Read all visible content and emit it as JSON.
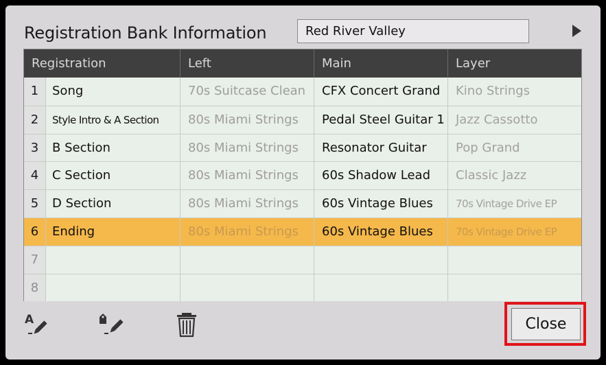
{
  "dialog": {
    "title": "Registration Bank Information",
    "bank_name": "Red River Valley",
    "close_label": "Close"
  },
  "table": {
    "headers": [
      "Registration",
      "Left",
      "Main",
      "Layer"
    ],
    "rows": [
      {
        "num": "1",
        "name": "Song",
        "left": "70s Suitcase Clean",
        "main": "CFX Concert Grand",
        "layer": "Kino Strings"
      },
      {
        "num": "2",
        "name": "Style Intro & A Section",
        "left": "80s Miami Strings",
        "main": "Pedal Steel Guitar 1",
        "layer": "Jazz Cassotto"
      },
      {
        "num": "3",
        "name": "B Section",
        "left": "80s Miami Strings",
        "main": "Resonator Guitar",
        "layer": "Pop Grand"
      },
      {
        "num": "4",
        "name": "C Section",
        "left": "80s Miami Strings",
        "main": "60s Shadow Lead",
        "layer": "Classic Jazz"
      },
      {
        "num": "5",
        "name": "D Section",
        "left": "80s Miami Strings",
        "main": "60s Vintage Blues",
        "layer": "70s Vintage Drive EP"
      },
      {
        "num": "6",
        "name": "Ending",
        "left": "80s Miami Strings",
        "main": "60s Vintage Blues",
        "layer": "70s Vintage Drive EP"
      },
      {
        "num": "7",
        "name": "",
        "left": "",
        "main": "",
        "layer": ""
      },
      {
        "num": "8",
        "name": "",
        "left": "",
        "main": "",
        "layer": ""
      }
    ],
    "selected_row": "6"
  },
  "toolbar": {
    "icons": [
      "rename-icon",
      "tag-edit-icon",
      "trash-icon"
    ]
  },
  "colors": {
    "selected_row": "#f5b84a",
    "header_bg": "#3f3f3f",
    "highlight_outline": "#e0141a"
  }
}
